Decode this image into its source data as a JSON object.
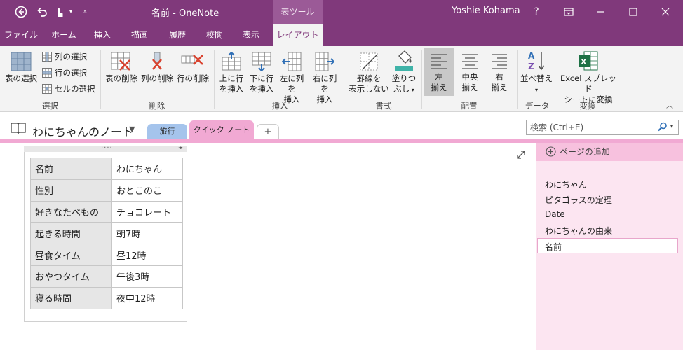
{
  "titlebar": {
    "title": "名前 - OneNote",
    "tools_tab": "表ツール",
    "user": "Yoshie Kohama",
    "help": "?"
  },
  "ribbon_tabs": [
    {
      "label": "ファイル"
    },
    {
      "label": "ホーム"
    },
    {
      "label": "挿入"
    },
    {
      "label": "描画"
    },
    {
      "label": "履歴"
    },
    {
      "label": "校閲"
    },
    {
      "label": "表示"
    },
    {
      "label": "レイアウト"
    }
  ],
  "ribbon": {
    "select": {
      "table": "表の選択",
      "col": "列の選択",
      "row": "行の選択",
      "cell": "セルの選択",
      "group": "選択"
    },
    "delete": {
      "table": "表の削除",
      "col": "列の削除",
      "row": "行の削除",
      "group": "削除"
    },
    "insert": {
      "above_1": "上に行",
      "above_2": "を挿入",
      "below_1": "下に行",
      "below_2": "を挿入",
      "left_1": "左に列を",
      "left_2": "挿入",
      "right_1": "右に列を",
      "right_2": "挿入",
      "group": "挿入"
    },
    "format": {
      "borders_1": "罫線を",
      "borders_2": "表示しない",
      "shading_1": "塗りつ",
      "shading_2": "ぶし",
      "group": "書式"
    },
    "align": {
      "left_1": "左",
      "left_2": "揃え",
      "center_1": "中央",
      "center_2": "揃え",
      "right_1": "右",
      "right_2": "揃え",
      "group": "配置"
    },
    "data": {
      "sort": "並べ替え",
      "group": "データ"
    },
    "convert": {
      "excel_1": "Excel スプレッド",
      "excel_2": "シートに変換",
      "group": "変換"
    }
  },
  "notebook": {
    "title": "わにちゃんのノート",
    "sections": [
      {
        "label": "旅行",
        "color": "#a5c4ec"
      },
      {
        "label": "クイック ノート",
        "color": "#f1a9d3"
      }
    ],
    "add_tab": "+",
    "search_placeholder": "検索 (Ctrl+E)"
  },
  "table": {
    "rows": [
      [
        "名前",
        "わにちゃん"
      ],
      [
        "性別",
        "おとこのこ"
      ],
      [
        "好きなたべもの",
        "チョコレート"
      ],
      [
        "起きる時間",
        "朝7時"
      ],
      [
        "昼食タイム",
        "昼12時"
      ],
      [
        "おやつタイム",
        "午後3時"
      ],
      [
        "寝る時間",
        "夜中12時"
      ]
    ]
  },
  "pages": {
    "add": "ページの追加",
    "items": [
      {
        "label": "わにちゃん"
      },
      {
        "label": "ピタゴラスの定理"
      },
      {
        "label": "Date"
      },
      {
        "label": "わにちゃんの由来"
      },
      {
        "label": "名前"
      }
    ]
  }
}
